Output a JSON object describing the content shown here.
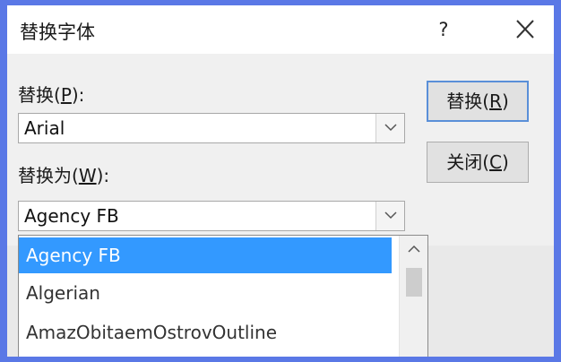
{
  "dialog": {
    "title": "替换字体",
    "help_label": "?",
    "close_icon": "close-icon"
  },
  "replace": {
    "label_prefix": "替换(",
    "label_key": "P",
    "label_suffix": "):",
    "value": "Arial"
  },
  "replace_with": {
    "label_prefix": "替换为(",
    "label_key": "W",
    "label_suffix": "):",
    "value": "Agency FB"
  },
  "buttons": {
    "replace_prefix": "替换(",
    "replace_key": "R",
    "replace_suffix": ")",
    "close_prefix": "关闭(",
    "close_key": "C",
    "close_suffix": ")"
  },
  "dropdown": {
    "items": [
      "Agency FB",
      "Algerian",
      "AmazObitaemOstrovOutline"
    ],
    "selected_index": 0
  },
  "colors": {
    "accent": "#3399ff",
    "background": "#5a78e6"
  }
}
